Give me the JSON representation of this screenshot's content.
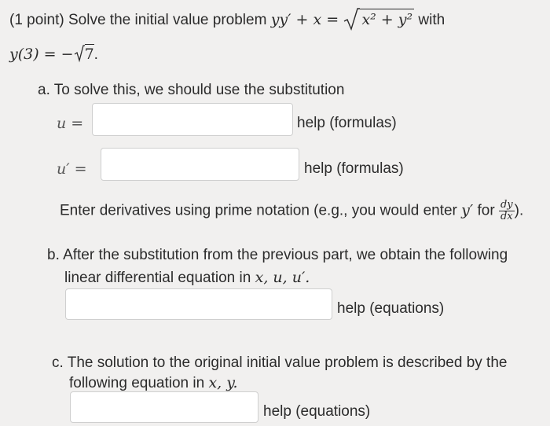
{
  "problem": {
    "intro": "(1 point) Solve the initial value problem",
    "equation_lhs": "yy′ + x =",
    "equation_rhs": "x² + y²",
    "with": "with",
    "initial_condition_lhs": "y(3) = −",
    "initial_condition_rad": "7",
    "initial_condition_end": "."
  },
  "part_a": {
    "prompt": "a. To solve this, we should use the substitution",
    "u_label": "u =",
    "u_value": "",
    "u_help": "help (formulas)",
    "uprime_label": "u′ =",
    "uprime_value": "",
    "uprime_help": "help (formulas)",
    "note_before": "Enter derivatives using prime notation (e.g., you would enter",
    "note_y": "y′",
    "note_for": "for",
    "note_frac_num": "dy",
    "note_frac_den": "dx",
    "note_end": ")."
  },
  "part_b": {
    "line1": "b. After the substitution from the previous part, we obtain the following",
    "line2_text": "linear differential equation in",
    "line2_vars": "x, u, u′.",
    "value": "",
    "help": "help (equations)"
  },
  "part_c": {
    "line1": "c. The solution to the original initial value problem is described by the",
    "line2_text": "following equation in",
    "line2_vars": "x, y.",
    "value": "",
    "help": "help (equations)"
  }
}
